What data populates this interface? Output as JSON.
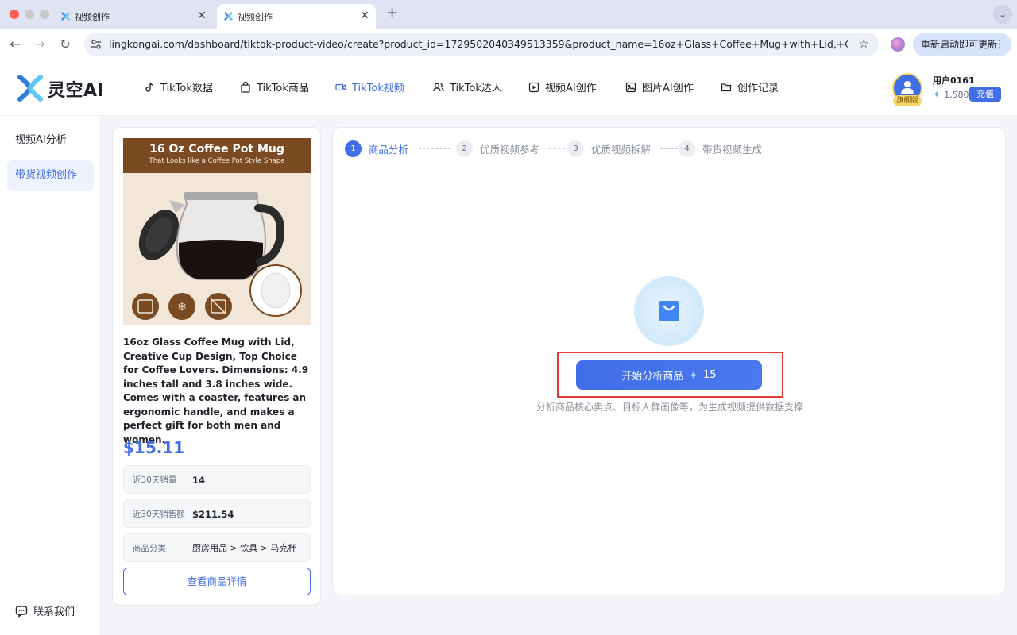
{
  "browser": {
    "tabs": [
      {
        "title": "视频创作",
        "active": false
      },
      {
        "title": "视频创作",
        "active": true
      }
    ],
    "url": "lingkongai.com/dashboard/tiktok-product-video/create?product_id=1729502040349513359&product_name=16oz+Glass+Coffee+Mug+with+Lid,+Creative+Cu...",
    "update_label": "重新启动即可更新"
  },
  "header": {
    "logo_text": "灵空AI",
    "nav": [
      {
        "label": "TikTok数据",
        "icon": "music-note-icon"
      },
      {
        "label": "TikTok商品",
        "icon": "shopping-bag-icon"
      },
      {
        "label": "TikTok视频",
        "icon": "video-camera-icon",
        "active": true
      },
      {
        "label": "TikTok达人",
        "icon": "users-icon"
      },
      {
        "label": "视频AI创作",
        "icon": "video-frame-icon"
      },
      {
        "label": "图片AI创作",
        "icon": "image-icon"
      },
      {
        "label": "创作记录",
        "icon": "folder-icon"
      }
    ],
    "user": {
      "name": "用户0161",
      "badge": "旗舰版",
      "credits": "1,580",
      "recharge_label": "充值"
    }
  },
  "sidebar": {
    "items": [
      {
        "label": "视频AI分析",
        "active": false
      },
      {
        "label": "带货视频创作",
        "active": true
      }
    ],
    "contact_label": "联系我们"
  },
  "product": {
    "image_title": "16 Oz Coffee Pot Mug",
    "image_subtitle": "That Looks like a Coffee Pot Style Shape",
    "title": "16oz Glass Coffee Mug with Lid, Creative Cup Design, Top Choice for Coffee Lovers. Dimensions: 4.9 inches tall and 3.8 inches wide. Comes with a coaster, features an ergonomic handle, and makes a perfect gift for both men and women.",
    "price": "$15.11",
    "stats": [
      {
        "label": "近30天销量",
        "value": "14"
      },
      {
        "label": "近30天销售额",
        "value": "$211.54"
      },
      {
        "label": "商品分类",
        "value": "厨房用品 > 饮具 > 马克杯"
      }
    ],
    "detail_button": "查看商品详情"
  },
  "main": {
    "steps": [
      {
        "num": "1",
        "label": "商品分析",
        "active": true
      },
      {
        "num": "2",
        "label": "优质视频参考",
        "active": false
      },
      {
        "num": "3",
        "label": "优质视频拆解",
        "active": false
      },
      {
        "num": "4",
        "label": "带货视频生成",
        "active": false
      }
    ],
    "analyze_button": "开始分析商品",
    "analyze_cost": "15",
    "hint": "分析商品核心卖点、目标人群画像等，为生成视频提供数据支撑"
  },
  "colors": {
    "accent": "#3f6ee8",
    "highlight": "#e53935"
  }
}
